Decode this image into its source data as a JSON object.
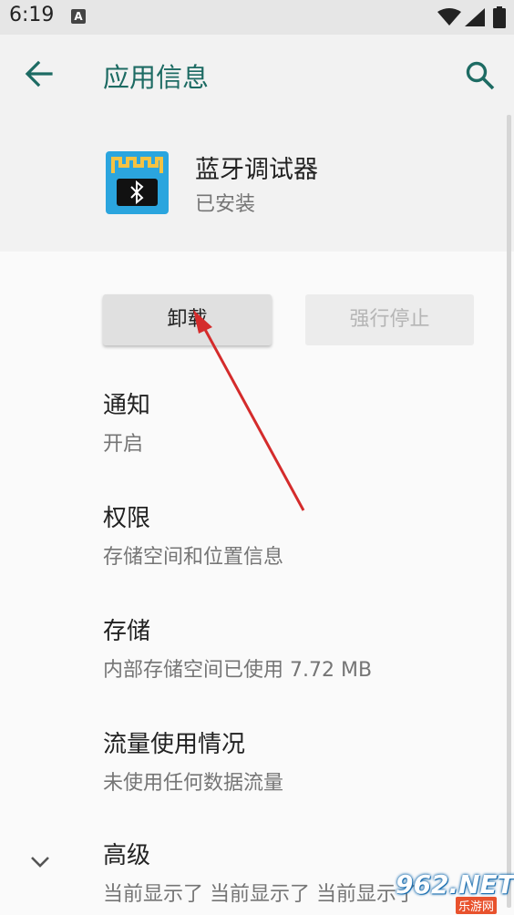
{
  "status_bar": {
    "time": "6:19",
    "indicator": "A"
  },
  "app_bar": {
    "title": "应用信息"
  },
  "app": {
    "name": "蓝牙调试器",
    "status": "已安装"
  },
  "actions": {
    "uninstall_label": "卸载",
    "force_stop_label": "强行停止"
  },
  "settings": [
    {
      "label": "通知",
      "sub": "开启"
    },
    {
      "label": "权限",
      "sub": "存储空间和位置信息"
    },
    {
      "label": "存储",
      "sub": "内部存储空间已使用 7.72 MB"
    },
    {
      "label": "流量使用情况",
      "sub": "未使用任何数据流量"
    },
    {
      "label": "高级",
      "sub": "当前显示了 当前显示了 当前显示了"
    }
  ],
  "watermark": {
    "main": "962.NET",
    "sub": "乐游网"
  },
  "colors": {
    "accent": "#1d6b63",
    "app_icon_bg": "#2ba5de",
    "annotation_arrow": "#d42b2b"
  },
  "icons": {
    "back": "arrow-left-icon",
    "search": "search-icon",
    "expand": "chevron-down-icon",
    "app": "bluetooth-debugger-app-icon"
  }
}
